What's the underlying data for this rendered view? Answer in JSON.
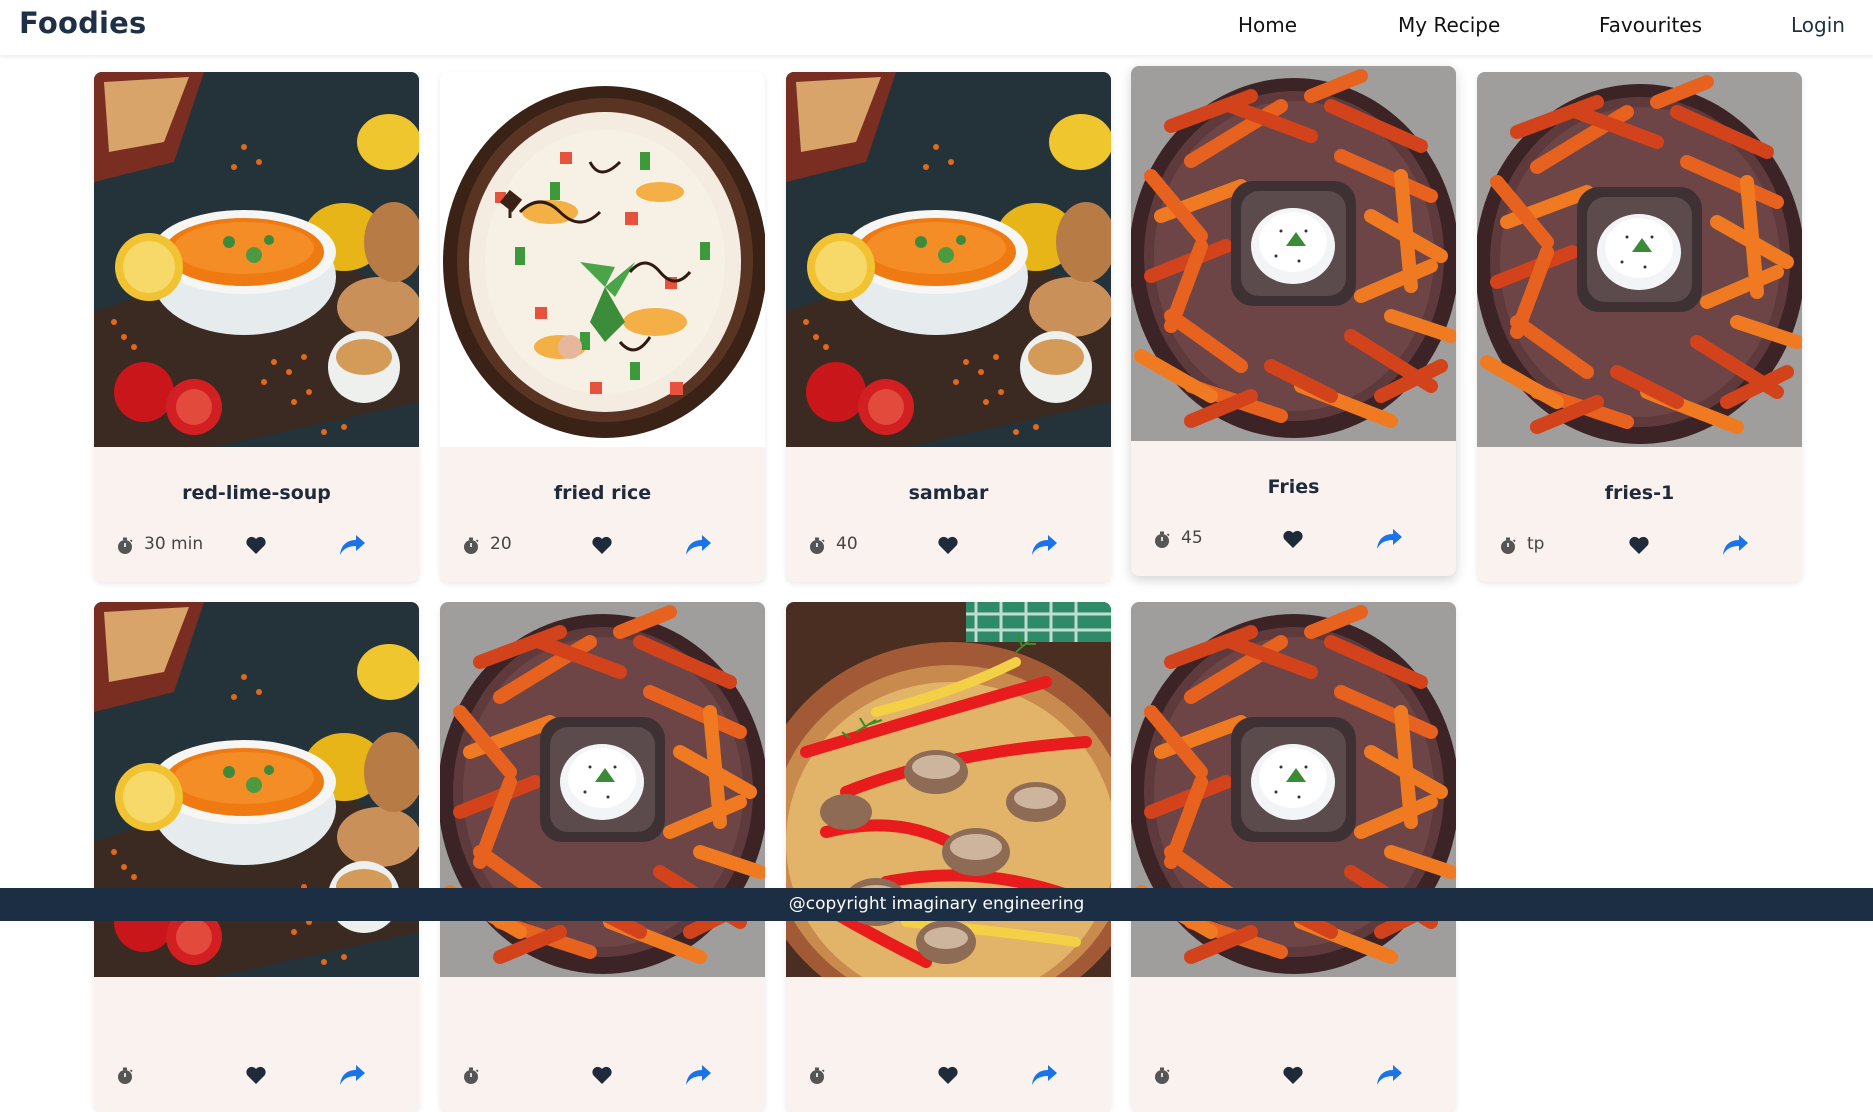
{
  "nav": {
    "brand": "Foodies",
    "links": [
      "Home",
      "My Recipe",
      "Favourites",
      "Login"
    ]
  },
  "recipes": [
    {
      "name": "red-lime-soup",
      "time": "30 min",
      "image": "soup"
    },
    {
      "name": "fried rice",
      "time": "20",
      "image": "rice"
    },
    {
      "name": "sambar",
      "time": "40",
      "image": "soup"
    },
    {
      "name": "Fries",
      "time": "45",
      "image": "fries"
    },
    {
      "name": "fries-1",
      "time": "tp",
      "image": "fries"
    },
    {
      "name": "",
      "time": "",
      "image": "soup"
    },
    {
      "name": "",
      "time": "",
      "image": "fries"
    },
    {
      "name": "",
      "time": "",
      "image": "mushroom"
    },
    {
      "name": "",
      "time": "",
      "image": "fries"
    }
  ],
  "icons": {
    "time": "stopwatch-icon",
    "favourite": "heart-icon",
    "share": "share-arrow-icon"
  },
  "colors": {
    "navy": "#1c2e44",
    "card_bg": "#faf2ee",
    "share_blue": "#1a73e8"
  },
  "footer": {
    "text": "@copyright imaginary engineering"
  }
}
